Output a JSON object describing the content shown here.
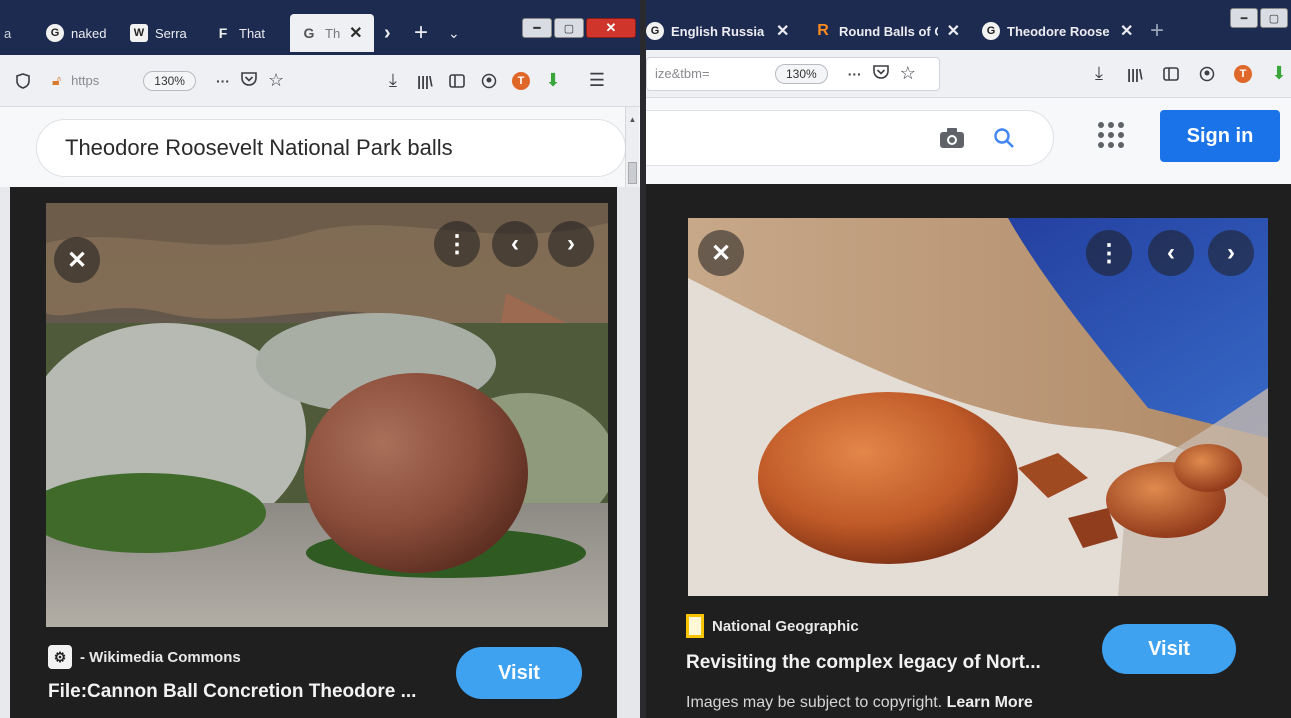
{
  "left_window": {
    "tabs": [
      {
        "favicon": "G",
        "title": "naked"
      },
      {
        "favicon": "W",
        "title": "Serra"
      },
      {
        "favicon": "F",
        "title": "That"
      },
      {
        "favicon": "G",
        "title": "Th"
      }
    ],
    "tab_partial_left": "a",
    "tab_close_glyph": "✕",
    "url": "https",
    "zoom": "130%",
    "more_glyph": "···",
    "search_query": "Theodore Roosevelt National Park balls",
    "result": {
      "source": "- Wikimedia Commons",
      "title": "File:Cannon Ball Concretion Theodore ...",
      "visit_label": "Visit"
    }
  },
  "right_window": {
    "tabs": [
      {
        "favicon": "G",
        "title": "English Russia"
      },
      {
        "favicon": "R",
        "title": "Round Balls of C"
      },
      {
        "favicon": "G",
        "title": "Theodore Roose"
      }
    ],
    "url": "ize&tbm=",
    "zoom": "130%",
    "more_glyph": "···",
    "sign_in_label": "Sign in",
    "result": {
      "source": "National Geographic",
      "title": "Revisiting the complex legacy of Nort...",
      "visit_label": "Visit",
      "copyright_text": "Images may be subject to copyright.",
      "learn_more_label": "Learn More"
    }
  },
  "colors": {
    "tabstrip": "#1c2b4f",
    "toolbar": "#eef0f3",
    "overlay": "#1f1f1f",
    "visit_button": "#3ea2f0",
    "sign_in_button": "#1a73e8",
    "window_close": "#d0352b"
  },
  "icons": [
    "shield-icon",
    "lock-icon",
    "pocket-icon",
    "star-icon",
    "download-icon",
    "library-icon",
    "sidebar-icon",
    "account-icon",
    "ublock-icon",
    "extension-arrow-icon",
    "camera-icon",
    "search-icon",
    "apps-grid-icon",
    "close-icon",
    "more-vert-icon",
    "chevron-left-icon",
    "chevron-right-icon"
  ]
}
